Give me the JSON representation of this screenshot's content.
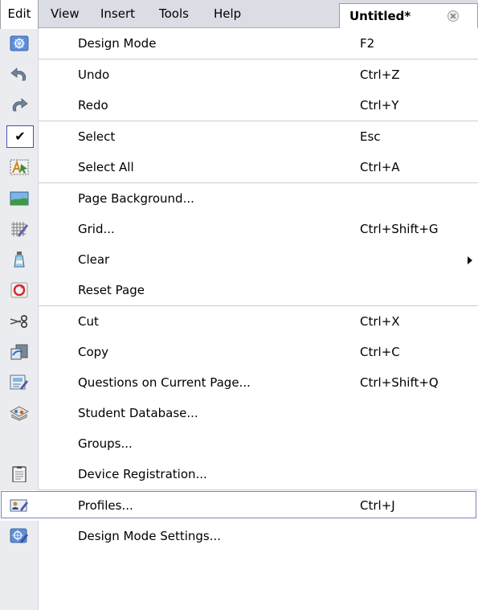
{
  "menubar": {
    "items": [
      {
        "label": "Edit"
      },
      {
        "label": "View"
      },
      {
        "label": "Insert"
      },
      {
        "label": "Tools"
      },
      {
        "label": "Help"
      }
    ],
    "document_tab": {
      "label": "Untitled*"
    }
  },
  "menu": {
    "items": [
      {
        "label": "Design Mode",
        "shortcut": "F2",
        "icon": "design-mode-icon"
      },
      {
        "label": "Undo",
        "shortcut": "Ctrl+Z",
        "icon": "undo-icon"
      },
      {
        "label": "Redo",
        "shortcut": "Ctrl+Y",
        "icon": "redo-icon"
      },
      {
        "label": "Select",
        "shortcut": "Esc",
        "icon": "check-icon",
        "checked": true
      },
      {
        "label": "Select All",
        "shortcut": "Ctrl+A",
        "icon": "select-all-icon"
      },
      {
        "label": "Page Background...",
        "shortcut": "",
        "icon": "page-background-icon"
      },
      {
        "label": "Grid...",
        "shortcut": "Ctrl+Shift+G",
        "icon": "grid-icon"
      },
      {
        "label": "Clear",
        "shortcut": "",
        "icon": "clear-icon",
        "submenu": true
      },
      {
        "label": "Reset Page",
        "shortcut": "",
        "icon": "reset-page-icon"
      },
      {
        "label": "Cut",
        "shortcut": "Ctrl+X",
        "icon": "cut-icon"
      },
      {
        "label": "Copy",
        "shortcut": "Ctrl+C",
        "icon": "copy-icon"
      },
      {
        "label": "Questions on Current Page...",
        "shortcut": "Ctrl+Shift+Q",
        "icon": "questions-icon"
      },
      {
        "label": "Student Database...",
        "shortcut": "",
        "icon": "student-database-icon"
      },
      {
        "label": "Groups...",
        "shortcut": "",
        "icon": ""
      },
      {
        "label": "Device Registration...",
        "shortcut": "",
        "icon": "device-registration-icon"
      },
      {
        "label": "Profiles...",
        "shortcut": "Ctrl+J",
        "icon": "profiles-icon",
        "highlighted": true
      },
      {
        "label": "Design Mode Settings...",
        "shortcut": "",
        "icon": "design-mode-settings-icon"
      }
    ],
    "check_glyph": "✔"
  }
}
